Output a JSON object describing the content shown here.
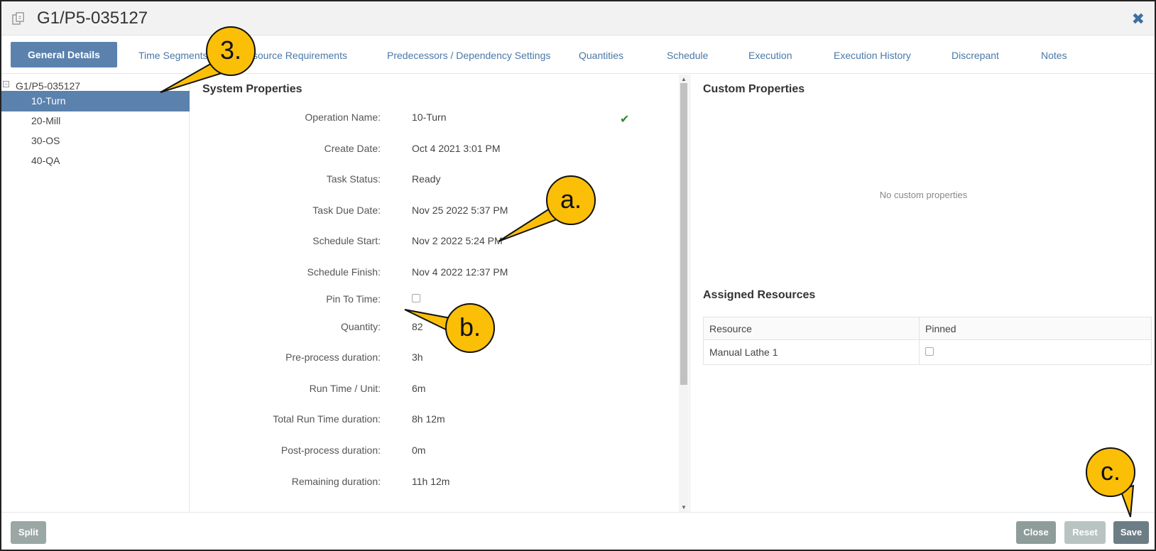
{
  "window": {
    "title": "G1/P5-035127",
    "close_icon": "close-x-icon",
    "title_icon": "document-copy-icon"
  },
  "tabs": [
    {
      "label": "General Details",
      "active": true
    },
    {
      "label": "Time Segments"
    },
    {
      "label": "Resource Requirements"
    },
    {
      "label": "Predecessors / Dependency Settings"
    },
    {
      "label": "Quantities"
    },
    {
      "label": "Schedule"
    },
    {
      "label": "Execution"
    },
    {
      "label": "Execution History"
    },
    {
      "label": "Discrepant"
    },
    {
      "label": "Notes"
    }
  ],
  "tree": {
    "root": "G1/P5-035127",
    "collapse_symbol": "⊟",
    "items": [
      "10-Turn",
      "20-Mill",
      "30-OS",
      "40-QA"
    ],
    "selected": "10-Turn"
  },
  "system_properties": {
    "title": "System Properties",
    "rows": [
      {
        "label": "Operation Name:",
        "value": "10-Turn"
      },
      {
        "label": "Create Date:",
        "value": "Oct 4 2021 3:01 PM"
      },
      {
        "label": "Task Status:",
        "value": "Ready"
      },
      {
        "label": "Task Due Date:",
        "value": "Nov 25 2022 5:37 PM"
      },
      {
        "label": "Schedule Start:",
        "value": "Nov 2 2022 5:24 PM"
      },
      {
        "label": "Schedule Finish:",
        "value": "Nov 4 2022 12:37 PM"
      },
      {
        "label": "Pin To Time:",
        "value": ""
      },
      {
        "label": "Quantity:",
        "value": "82"
      },
      {
        "label": "Pre-process duration:",
        "value": "3h"
      },
      {
        "label": "Run Time / Unit:",
        "value": "6m"
      },
      {
        "label": "Total Run Time duration:",
        "value": "8h 12m"
      },
      {
        "label": "Post-process duration:",
        "value": "0m"
      },
      {
        "label": "Remaining duration:",
        "value": "11h 12m"
      }
    ],
    "valid_icon": "checkmark-icon",
    "pin_to_time_checked": false
  },
  "custom_properties": {
    "title": "Custom Properties",
    "empty_message": "No custom properties"
  },
  "assigned_resources": {
    "title": "Assigned Resources",
    "columns": [
      "Resource",
      "Pinned"
    ],
    "rows": [
      {
        "resource": "Manual Lathe 1",
        "pinned": false
      }
    ]
  },
  "footer": {
    "split_label": "Split",
    "close_label": "Close",
    "reset_label": "Reset",
    "save_label": "Save"
  },
  "callouts": {
    "three": "3.",
    "a": "a.",
    "b": "b.",
    "c": "c.",
    "fill_color": "#fbbf08"
  },
  "scroll_arrows": {
    "up": "▲",
    "down": "▼"
  }
}
